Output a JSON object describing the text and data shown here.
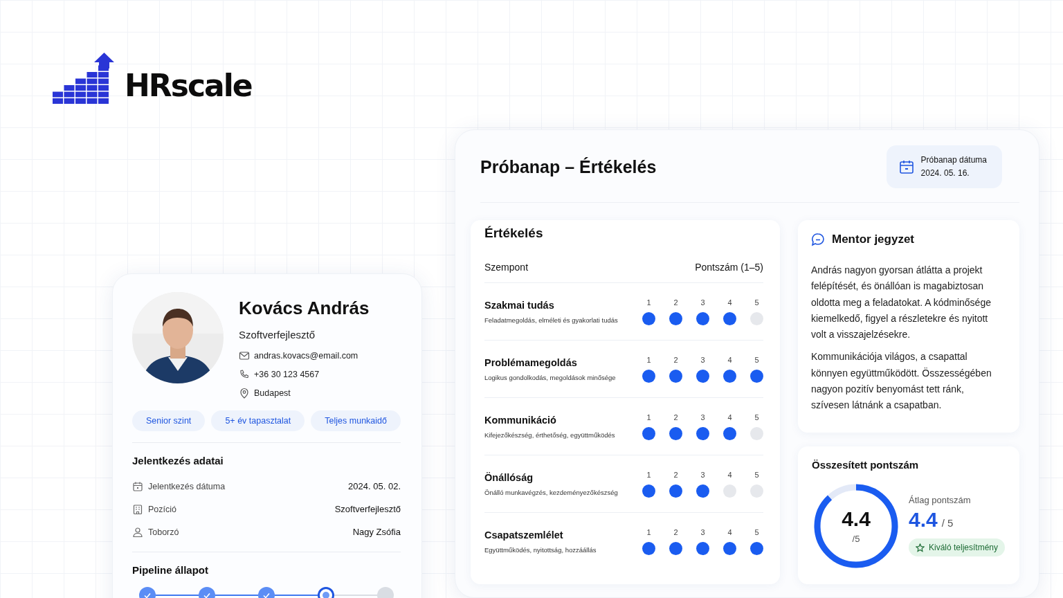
{
  "logo": {
    "text": "HRscale"
  },
  "profile": {
    "name": "Kovács András",
    "role": "Szoftverfejlesztő",
    "contacts": [
      {
        "kind": "email",
        "text": "andras.kovacs@email.com"
      },
      {
        "kind": "phone",
        "text": "+36 30 123 4567"
      },
      {
        "kind": "location",
        "text": "Budapest"
      }
    ],
    "tags": [
      "Senior szint",
      "5+ év tapasztalat",
      "Teljes munkaidő"
    ],
    "application": {
      "title": "Jelentkezés adatai",
      "rows": [
        {
          "kind": "date",
          "label": "Jelentkezés dátuma",
          "value": "2024. 05. 02."
        },
        {
          "kind": "position",
          "label": "Pozíció",
          "value": "Szoftverfejlesztő"
        },
        {
          "kind": "recruiter",
          "label": "Toborzó",
          "value": "Nagy Zsófia"
        }
      ]
    },
    "pipeline": {
      "title": "Pipeline állapot",
      "steps": [
        {
          "kind": "done"
        },
        {
          "kind": "done"
        },
        {
          "kind": "done"
        },
        {
          "kind": "current"
        },
        {
          "kind": "pending"
        }
      ]
    }
  },
  "evaluation": {
    "title": "Próbanap – Értékelés",
    "date": {
      "label": "Próbanap dátuma",
      "value": "2024. 05. 16."
    },
    "rating": {
      "title": "Értékelés",
      "columns": [
        "Szempont",
        "Pontszám (1–5)"
      ],
      "criteria": [
        {
          "name": "Szakmai tudás",
          "description": "Feladatmegoldás, elméleti és gyakorlati tudás",
          "points": [
            {
              "label": "1",
              "filled": true
            },
            {
              "label": "2",
              "filled": true
            },
            {
              "label": "3",
              "filled": true
            },
            {
              "label": "4",
              "filled": true
            },
            {
              "label": "5",
              "filled": false
            }
          ]
        },
        {
          "name": "Problémamegoldás",
          "description": "Logikus gondolkodás, megoldások minősége",
          "points": [
            {
              "label": "1",
              "filled": true
            },
            {
              "label": "2",
              "filled": true
            },
            {
              "label": "3",
              "filled": true
            },
            {
              "label": "4",
              "filled": true
            },
            {
              "label": "5",
              "filled": true
            }
          ]
        },
        {
          "name": "Kommunikáció",
          "description": "Kifejezőkészség, érthetőség, együttműködés",
          "points": [
            {
              "label": "1",
              "filled": true
            },
            {
              "label": "2",
              "filled": true
            },
            {
              "label": "3",
              "filled": true
            },
            {
              "label": "4",
              "filled": true
            },
            {
              "label": "5",
              "filled": false
            }
          ]
        },
        {
          "name": "Önállóság",
          "description": "Önálló munkavégzés, kezdeményezőkészség",
          "points": [
            {
              "label": "1",
              "filled": true
            },
            {
              "label": "2",
              "filled": true
            },
            {
              "label": "3",
              "filled": true
            },
            {
              "label": "4",
              "filled": false
            },
            {
              "label": "5",
              "filled": false
            }
          ]
        },
        {
          "name": "Csapatszemlélet",
          "description": "Együttműködés, nyitottság, hozzáállás",
          "points": [
            {
              "label": "1",
              "filled": true
            },
            {
              "label": "2",
              "filled": true
            },
            {
              "label": "3",
              "filled": true
            },
            {
              "label": "4",
              "filled": true
            },
            {
              "label": "5",
              "filled": true
            }
          ]
        }
      ]
    },
    "mentor": {
      "title": "Mentor jegyzet",
      "paragraphs": [
        "András nagyon gyorsan átlátta a projekt felépítését, és önállóan is magabiztosan oldotta meg a feladatokat. A kódminősége kiemelkedő, figyel a részletekre és nyitott volt a visszajelzésekre.",
        "Kommunikációja világos, a csapattal könnyen együttműködött. Összességében nagyon pozitív benyomást tett ránk, szívesen látnánk a csapatban."
      ]
    },
    "summary": {
      "title": "Összesített pontszám",
      "score": "4.4",
      "out_of": "/5",
      "level": 0.88,
      "average_label": "Átlag pontszám",
      "average": "4.4",
      "average_out_of": "/ 5",
      "badge": "Kiváló teljesítmény"
    }
  }
}
